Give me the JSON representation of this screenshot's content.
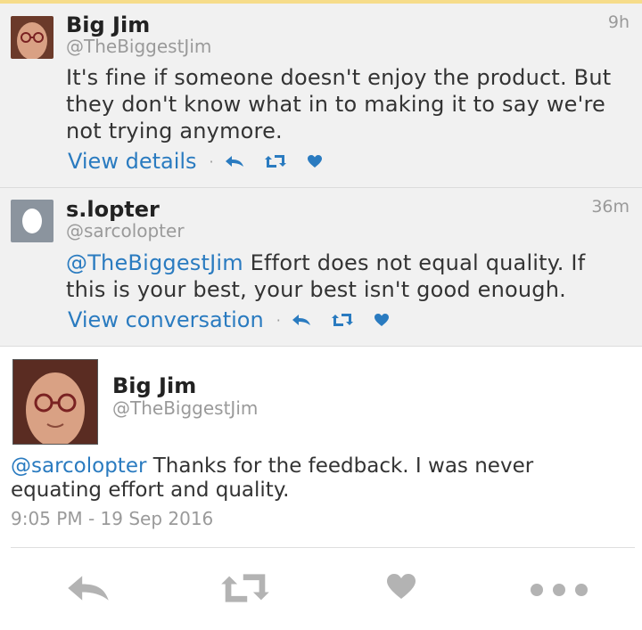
{
  "tweets": [
    {
      "name": "Big Jim",
      "handle": "@TheBiggestJim",
      "time": "9h",
      "text": "It's fine if someone doesn't enjoy the product. But they don't know what in to making it to say we're not trying anymore.",
      "action_link": "View details"
    },
    {
      "name": "s.lopter",
      "handle": "@sarcolopter",
      "time": "36m",
      "mention": "@TheBiggestJim",
      "text": " Effort does not equal quality. If this is your best, your best isn't good enough.",
      "action_link": "View conversation"
    }
  ],
  "detail": {
    "name": "Big Jim",
    "handle": "@TheBiggestJim",
    "mention": "@sarcolopter",
    "text": " Thanks for the feedback. I was never equating effort and quality.",
    "timestamp": "9:05 PM - 19 Sep 2016"
  },
  "icons": {
    "reply": "reply-icon",
    "retweet": "retweet-icon",
    "like": "heart-icon",
    "more": "more-icon"
  },
  "colors": {
    "link": "#2a7bc0",
    "muted": "#9a9a9a",
    "icon_gray": "#b3b3b3",
    "top_accent": "#f6dc8a"
  }
}
